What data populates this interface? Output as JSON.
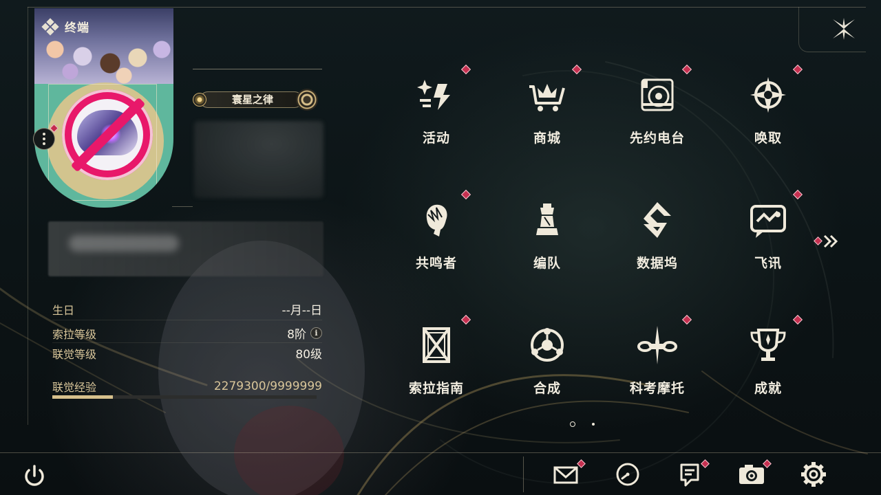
{
  "header": {
    "title": "终端"
  },
  "profile": {
    "title_plate": "寰星之律",
    "stats": {
      "birthday_label": "生日",
      "birthday_value": "--月--日",
      "sola_level_label": "索拉等级",
      "sola_level_value": "8阶",
      "union_level_label": "联觉等级",
      "union_level_value": "80级",
      "union_exp_label": "联觉经验",
      "union_exp_value": "2279300/9999999",
      "union_exp_progress": 0.228
    }
  },
  "grid": {
    "items": [
      {
        "label": "活动",
        "icon": "event-icon",
        "alert": true
      },
      {
        "label": "商城",
        "icon": "shop-cart-icon",
        "alert": true
      },
      {
        "label": "先约电台",
        "icon": "radio-icon",
        "alert": true
      },
      {
        "label": "唤取",
        "icon": "convene-star-icon",
        "alert": true
      },
      {
        "label": "共鸣者",
        "icon": "resonator-portrait-icon",
        "alert": true
      },
      {
        "label": "编队",
        "icon": "chess-team-icon",
        "alert": false
      },
      {
        "label": "数据坞",
        "icon": "databank-icon",
        "alert": false
      },
      {
        "label": "飞讯",
        "icon": "message-chat-icon",
        "alert": true
      },
      {
        "label": "索拉指南",
        "icon": "guidebook-icon",
        "alert": true
      },
      {
        "label": "合成",
        "icon": "synthesis-icon",
        "alert": false
      },
      {
        "label": "科考摩托",
        "icon": "motorbike-icon",
        "alert": true
      },
      {
        "label": "成就",
        "icon": "trophy-icon",
        "alert": true
      }
    ],
    "current_page": 1,
    "page_count": 2
  },
  "bottom_bar": {
    "items": [
      {
        "icon": "mail-icon",
        "alert": true
      },
      {
        "icon": "clock-icon",
        "alert": false
      },
      {
        "icon": "notice-icon",
        "alert": true
      },
      {
        "icon": "camera-icon",
        "alert": true
      },
      {
        "icon": "gear-icon",
        "alert": false
      }
    ]
  },
  "colors": {
    "accent_gold": "#d6c08c",
    "alert_red": "#c63050",
    "text_main": "#f2ede0",
    "label_gold": "#d9c69a"
  }
}
